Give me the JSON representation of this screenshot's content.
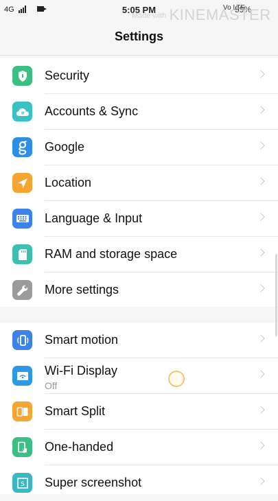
{
  "status_bar": {
    "network": "4G",
    "time": "5:05 PM",
    "battery": "59%",
    "volte": "Vo LTE"
  },
  "watermark": {
    "small": "Made with",
    "big": "KINEMASTER"
  },
  "header": {
    "title": "Settings"
  },
  "group1": [
    {
      "label": "Security",
      "icon": "shield-icon",
      "color": "#3cbf83"
    },
    {
      "label": "Accounts & Sync",
      "icon": "cloud-sync-icon",
      "color": "#39c1c4"
    },
    {
      "label": "Google",
      "icon": "google-g-icon",
      "color": "#2d8ee6"
    },
    {
      "label": "Location",
      "icon": "location-arrow-icon",
      "color": "#f5a531"
    },
    {
      "label": "Language & Input",
      "icon": "keyboard-icon",
      "color": "#3c82e8"
    },
    {
      "label": "RAM and storage space",
      "icon": "sd-card-icon",
      "color": "#3cbfae"
    },
    {
      "label": "More settings",
      "icon": "wrench-icon",
      "color": "#9b9b9b"
    }
  ],
  "group2": [
    {
      "label": "Smart motion",
      "icon": "phone-motion-icon",
      "color": "#3c82e8"
    },
    {
      "label": "Wi-Fi Display",
      "sub": "Off",
      "icon": "wifi-display-icon",
      "color": "#2d98e6"
    },
    {
      "label": "Smart Split",
      "icon": "split-screen-icon",
      "color": "#f5a531"
    },
    {
      "label": "One-handed",
      "icon": "one-hand-icon",
      "color": "#3cbf83"
    },
    {
      "label": "Super screenshot",
      "icon": "screenshot-icon",
      "color": "#39b7c4"
    }
  ]
}
